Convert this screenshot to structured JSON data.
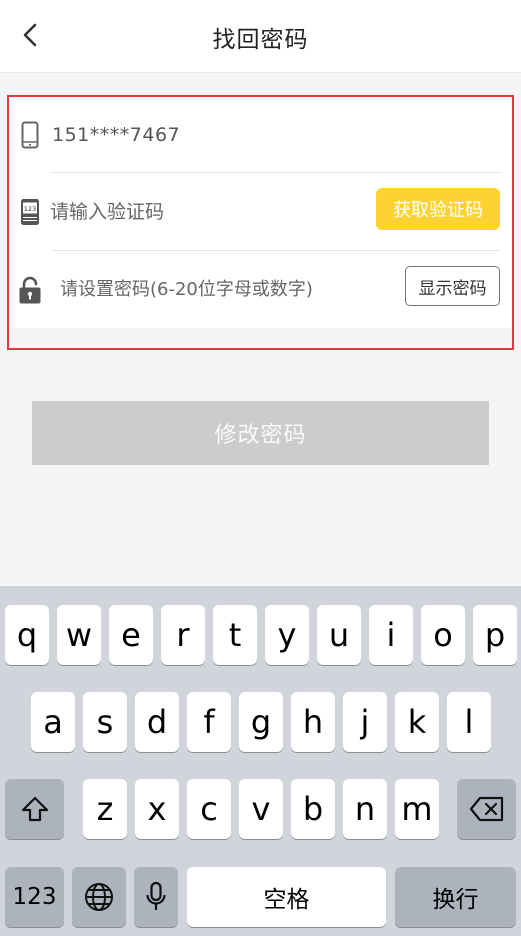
{
  "header": {
    "title": "找回密码"
  },
  "form": {
    "phone_value": "151****7467",
    "code_placeholder": "请输入验证码",
    "get_code_label": "获取验证码",
    "password_placeholder": "请设置密码(6-20位字母或数字)",
    "show_password_label": "显示密码"
  },
  "submit_label": "修改密码",
  "keyboard": {
    "row1": [
      "q",
      "w",
      "e",
      "r",
      "t",
      "y",
      "u",
      "i",
      "o",
      "p"
    ],
    "row2": [
      "a",
      "s",
      "d",
      "f",
      "g",
      "h",
      "j",
      "k",
      "l"
    ],
    "row3": [
      "z",
      "x",
      "c",
      "v",
      "b",
      "n",
      "m"
    ],
    "numbers_label": "123",
    "space_label": "空格",
    "return_label": "换行",
    "icons": {
      "shift": "shift-icon",
      "backspace": "backspace-icon",
      "globe": "globe-icon",
      "mic": "microphone-icon"
    }
  },
  "colors": {
    "accent": "#fdd334",
    "highlight_outline": "#e03a3e",
    "disabled_button": "#cccccc"
  }
}
